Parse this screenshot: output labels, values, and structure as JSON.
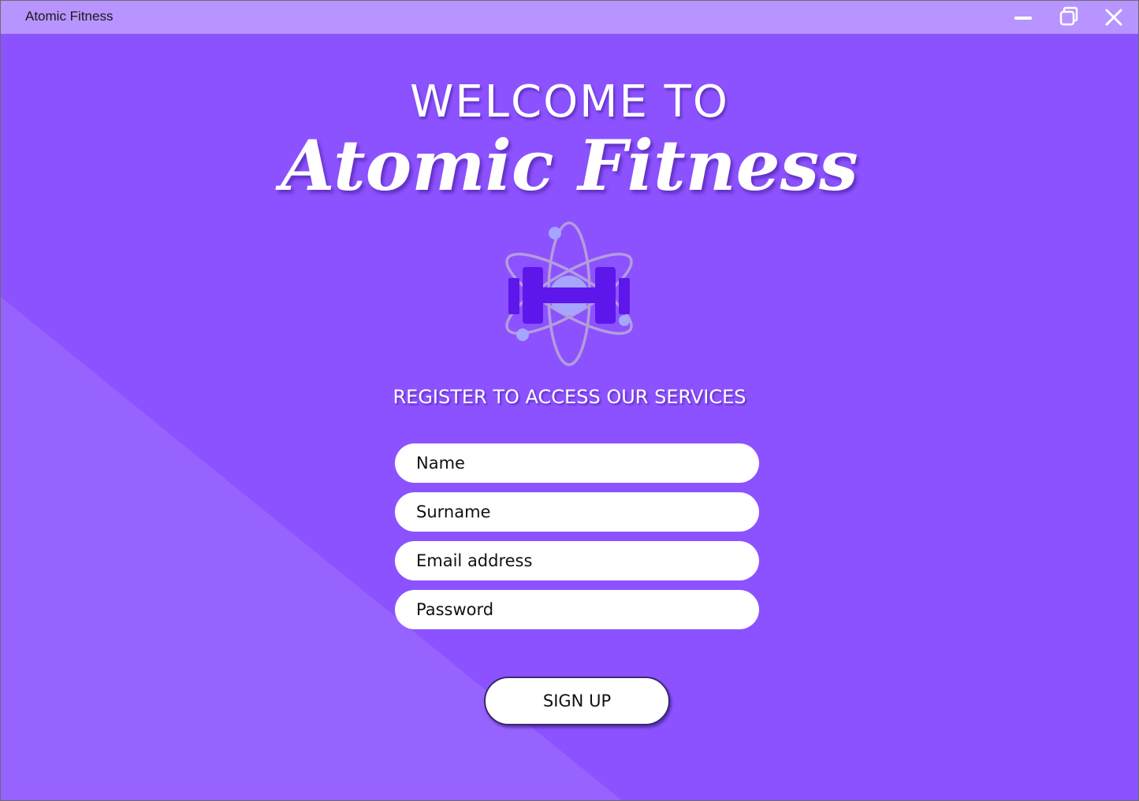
{
  "window": {
    "title": "Atomic Fitness",
    "controls": {
      "minimize_icon": "minimize-icon",
      "maximize_icon": "restore-icon",
      "close_icon": "close-icon"
    }
  },
  "hero": {
    "welcome": "WELCOME TO",
    "brand": "Atomic Fitness",
    "logo_icon": "atom-dumbbell-icon",
    "subtitle": "REGISTER TO ACCESS OUR SERVICES"
  },
  "form": {
    "name_placeholder": "Name",
    "surname_placeholder": "Surname",
    "email_placeholder": "Email address",
    "password_placeholder": "Password",
    "name_value": "",
    "surname_value": "",
    "email_value": "",
    "password_value": "",
    "submit_label": "SIGN UP"
  },
  "colors": {
    "background": "#8c52ff",
    "background_accent": "#9763ff",
    "titlebar": "#b794ff",
    "logo_dark": "#5e17eb",
    "logo_light": "#a6a6ff",
    "logo_orbit": "#b39ddb"
  }
}
